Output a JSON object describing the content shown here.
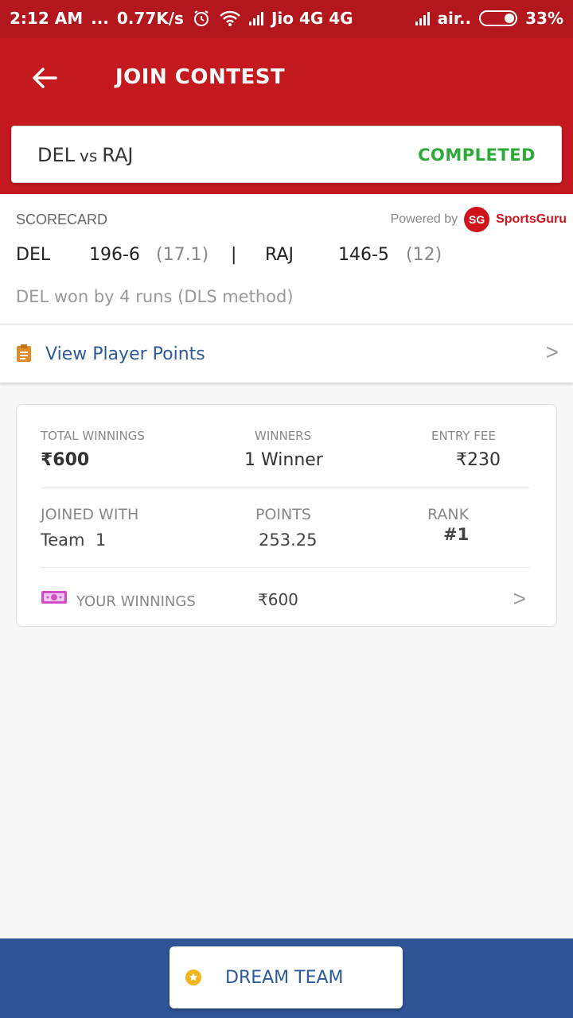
{
  "status_bar": {
    "time": "2:12 AM",
    "dots": "...",
    "speed": "0.77K/s",
    "carrier1": "Jio 4G 4G",
    "carrier2": "air..",
    "battery": "33%",
    "icons": [
      "alarm-icon",
      "wifi-icon",
      "signal-icon",
      "battery-icon"
    ]
  },
  "header": {
    "title": "JOIN CONTEST",
    "back_icon": "arrow-left-icon",
    "bg_color": "#c4191f"
  },
  "match": {
    "team1": "DEL",
    "vs": "vs",
    "team2": "RAJ",
    "status": "COMPLETED",
    "status_color": "#2eaa3a"
  },
  "scorecard": {
    "label": "SCORECARD",
    "powered_by": "Powered by",
    "provider_logo": "SG",
    "provider": "SportsGuru",
    "team1": "DEL",
    "team1_score": "196-6",
    "team1_overs": "(17.1)",
    "separator": "|",
    "team2": "RAJ",
    "team2_score": "146-5",
    "team2_overs": "(12)",
    "result": "DEL won by 4 runs (DLS method)"
  },
  "player_points": {
    "label": "View Player Points",
    "icon": "clipboard-icon",
    "chevron": ">"
  },
  "contest": {
    "total_winnings_label": "TOTAL WINNINGS",
    "total_winnings": "₹600",
    "winners_label": "WINNERS",
    "winners": "1 Winner",
    "entry_fee_label": "ENTRY FEE",
    "entry_fee": "₹230",
    "joined_with_label": "JOINED WITH",
    "joined_with": "Team  1",
    "points_label": "POINTS",
    "points": "253.25",
    "rank_label": "RANK",
    "rank": "#1",
    "your_winnings_label": "YOUR WINNINGS",
    "your_winnings": "₹600",
    "your_winnings_icon": "money-icon",
    "chevron": ">"
  },
  "bottom": {
    "button_label": "DREAM TEAM",
    "button_icon": "star-icon",
    "bg_color": "#2f5597"
  }
}
